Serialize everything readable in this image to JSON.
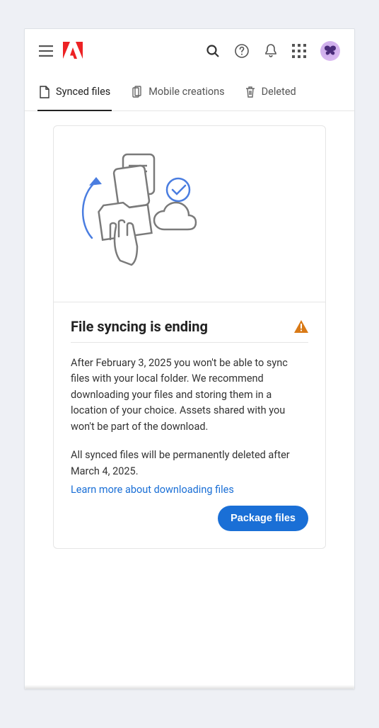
{
  "header": {
    "icons": {
      "menu": "menu",
      "logo": "adobe-logo",
      "search": "search",
      "help": "help",
      "notifications": "notifications",
      "apps": "apps-grid",
      "avatar": "avatar"
    }
  },
  "tabs": [
    {
      "label": "Synced files",
      "icon": "file",
      "active": true
    },
    {
      "label": "Mobile creations",
      "icon": "mobile-stack",
      "active": false
    },
    {
      "label": "Deleted",
      "icon": "trash",
      "active": false
    }
  ],
  "card": {
    "title": "File syncing is ending",
    "paragraph1": "After February 3, 2025 you won't be able to sync files with your local folder. We recommend downloading your files and storing them in a location of your choice. Assets shared with you won't be part of the download.",
    "paragraph2": "All synced files will be permanently deleted after March 4, 2025.",
    "link_label": "Learn more about downloading files",
    "button_label": "Package files",
    "warning_icon": "warning"
  }
}
